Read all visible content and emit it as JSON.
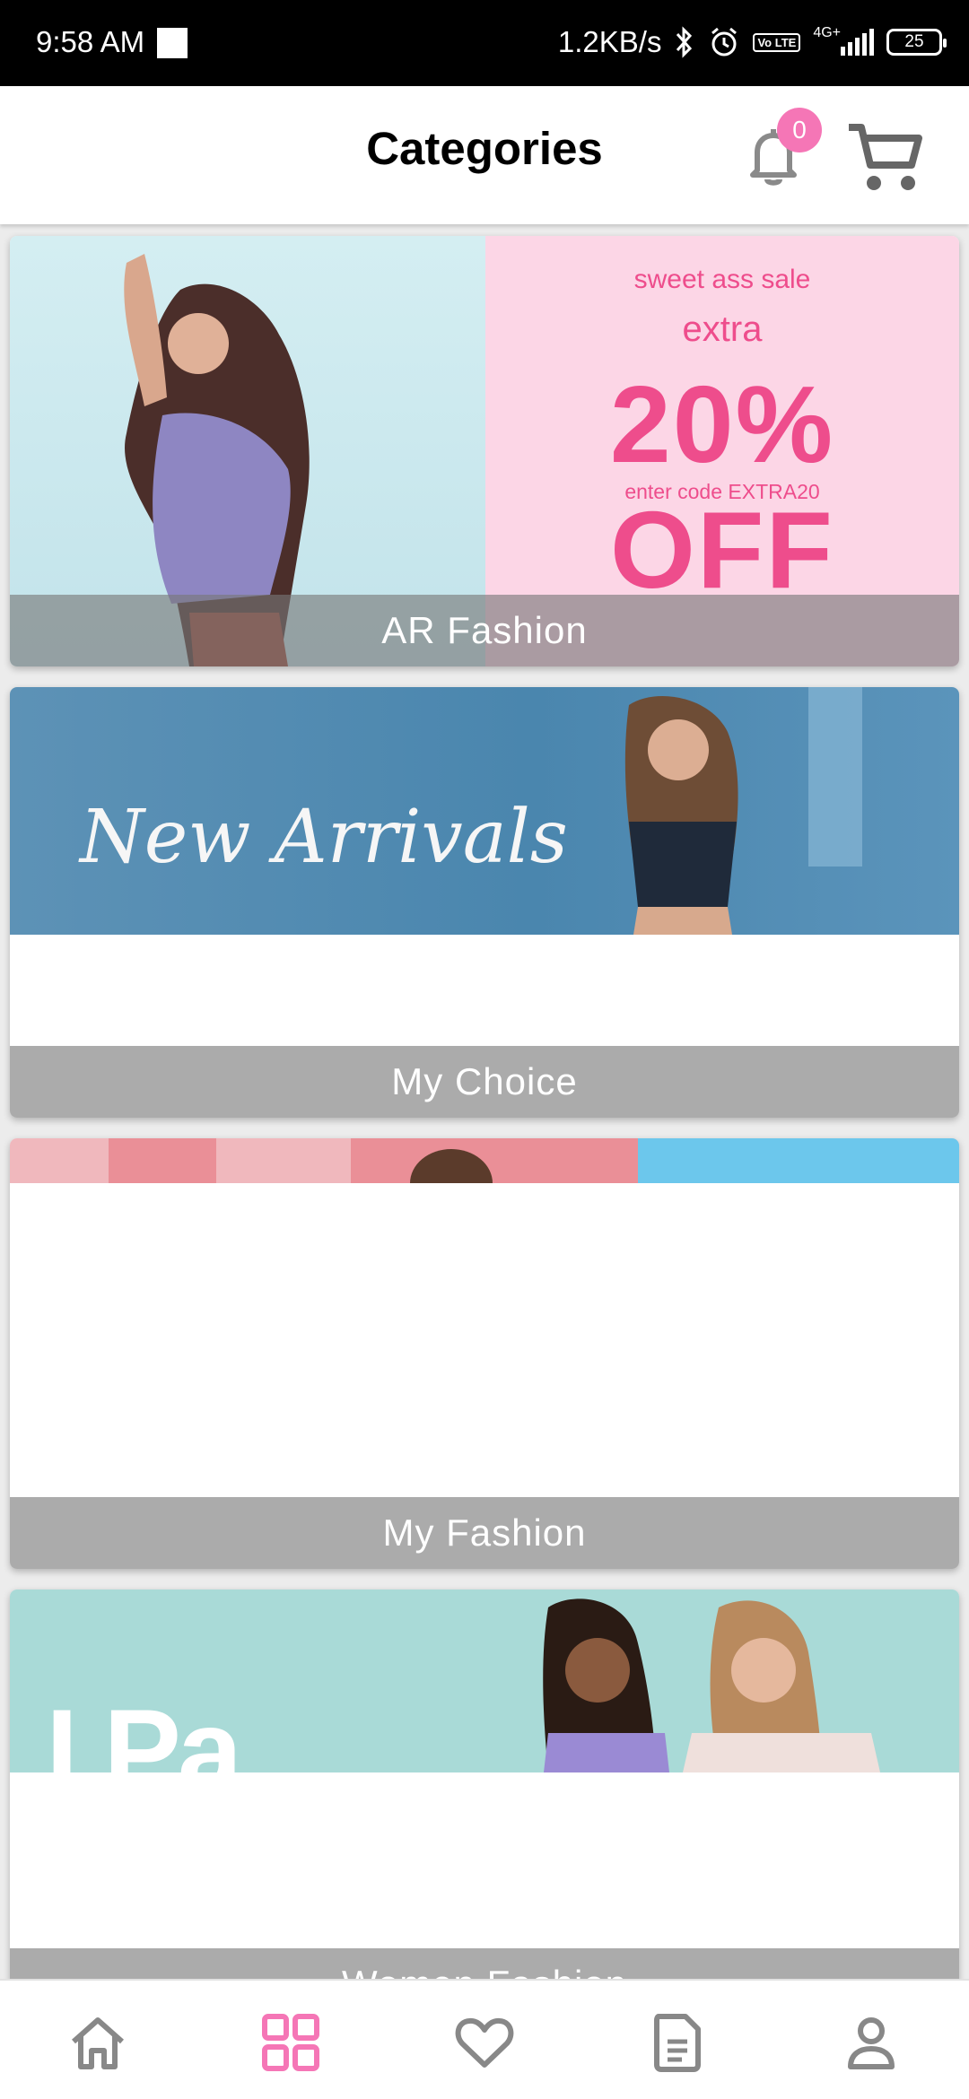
{
  "status_bar": {
    "time": "9:58 AM",
    "speed": "1.2KB/s",
    "lte": "Vo LTE",
    "network": "4G+",
    "battery": "25"
  },
  "header": {
    "title": "Categories",
    "notification_count": "0"
  },
  "categories": [
    {
      "label": "AR Fashion",
      "banner": {
        "line1": "sweet ass sale",
        "line2": "extra",
        "line3": "20% OFF",
        "line4": "enter code EXTRA20"
      }
    },
    {
      "label": "My Choice",
      "banner": {
        "script": "New Arrivals"
      }
    },
    {
      "label": "My Fashion"
    },
    {
      "label": "Women Fashion",
      "banner": {
        "partial_text": "I Pa..."
      }
    }
  ],
  "bottom_nav": [
    {
      "name": "home",
      "icon": "home-icon",
      "active": false
    },
    {
      "name": "categories",
      "icon": "grid-icon",
      "active": true
    },
    {
      "name": "wishlist",
      "icon": "heart-icon",
      "active": false
    },
    {
      "name": "orders",
      "icon": "document-icon",
      "active": false
    },
    {
      "name": "profile",
      "icon": "person-icon",
      "active": false
    }
  ],
  "colors": {
    "accent": "#f576b6",
    "inactive_icon": "#888888",
    "label_overlay": "rgba(120,120,120,0.62)",
    "promo_pink": "#ee4d8c"
  }
}
